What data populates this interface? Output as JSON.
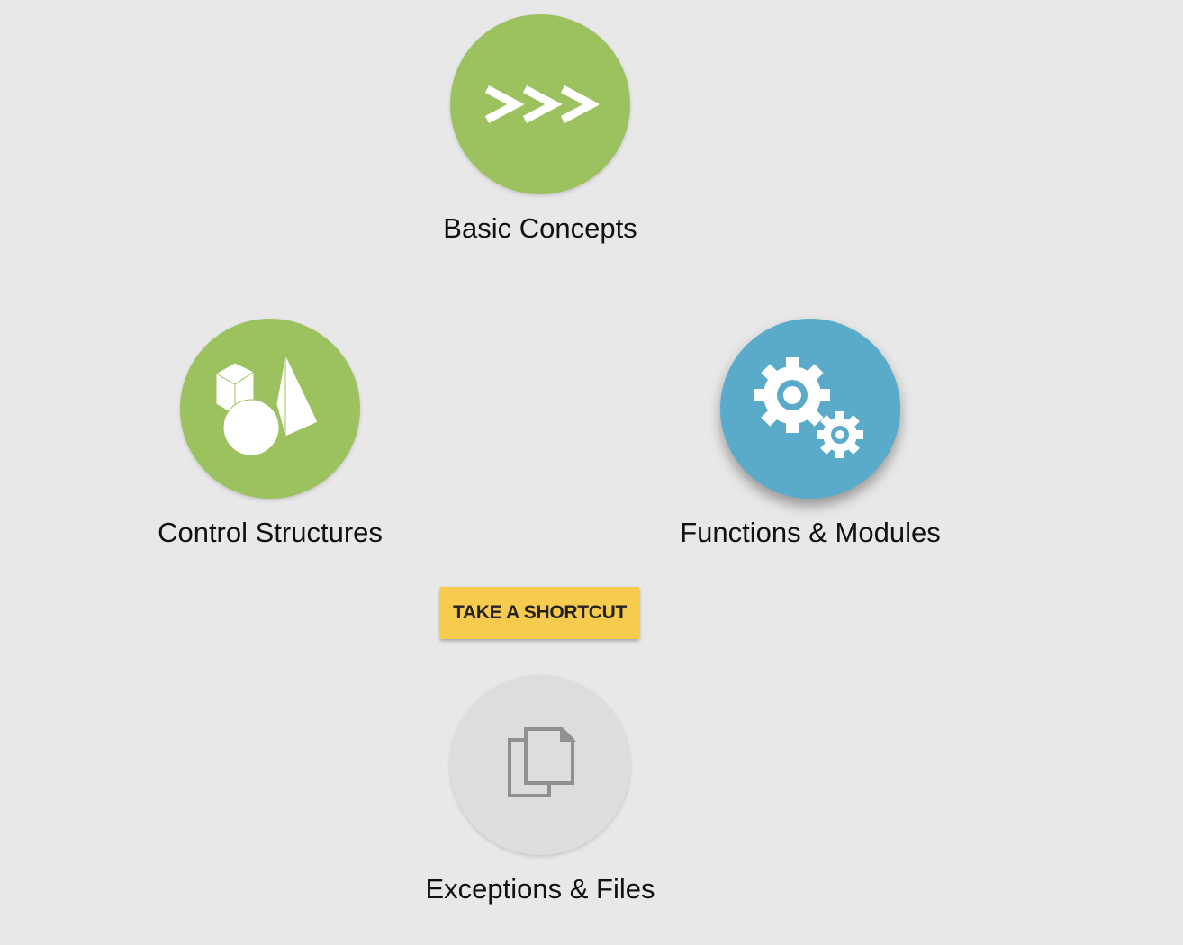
{
  "nodes": [
    {
      "label": "Basic Concepts",
      "icon": "chevrons-icon",
      "color": "#9bc25f"
    },
    {
      "label": "Control Structures",
      "icon": "shapes-icon",
      "color": "#9bc25f"
    },
    {
      "label": "Functions & Modules",
      "icon": "gears-icon",
      "color": "#5aaac9"
    },
    {
      "label": "Exceptions & Files",
      "icon": "files-icon",
      "color": "#dddddd"
    }
  ],
  "shortcut": {
    "label": "TAKE A SHORTCUT",
    "color": "#f7cb4d"
  }
}
